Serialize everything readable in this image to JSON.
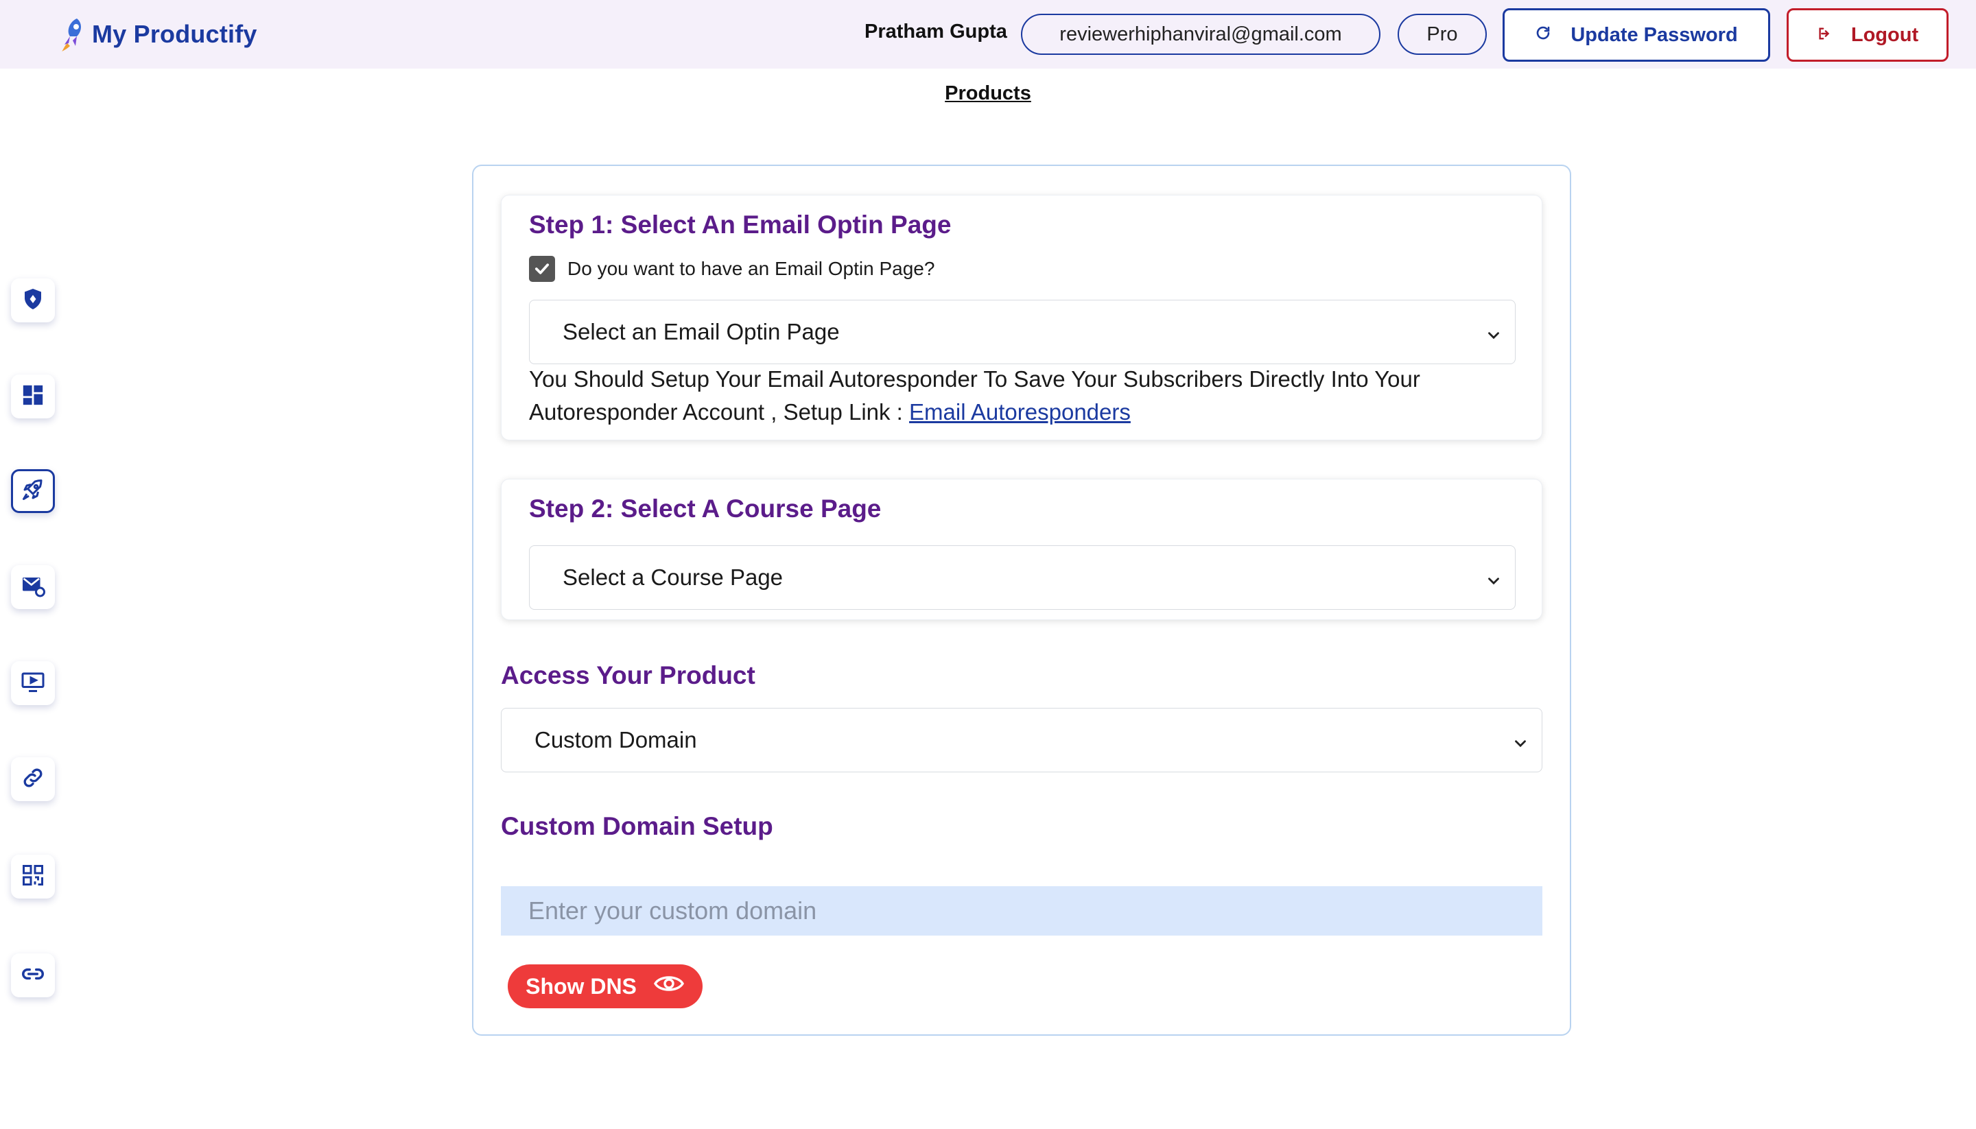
{
  "header": {
    "brand": "My Productify",
    "user_name": "Pratham Gupta",
    "email": "reviewerhiphanviral@gmail.com",
    "plan": "Pro",
    "update_password_label": "Update Password",
    "logout_label": "Logout"
  },
  "nav": {
    "current_page": "Products"
  },
  "sidebar": {
    "items": [
      {
        "icon": "shield-icon"
      },
      {
        "icon": "dashboard-icon"
      },
      {
        "icon": "rocket-icon",
        "active": true
      },
      {
        "icon": "mail-icon"
      },
      {
        "icon": "video-icon"
      },
      {
        "icon": "link-icon"
      },
      {
        "icon": "qr-code-icon"
      },
      {
        "icon": "chain-link-icon"
      }
    ]
  },
  "step1": {
    "title": "Step 1: Select An Email Optin Page",
    "checkbox_label": "Do you want to have an Email Optin Page?",
    "checkbox_checked": true,
    "select_value": "Select an Email Optin Page",
    "note_text": "You Should Setup Your Email Autoresponder To Save Your Subscribers Directly Into Your Autoresponder Account , Setup Link : ",
    "note_link": "Email Autoresponders"
  },
  "step2": {
    "title": "Step 2: Select A Course Page",
    "select_value": "Select a Course Page"
  },
  "access": {
    "title": "Access Your Product",
    "select_value": "Custom Domain"
  },
  "custom_domain": {
    "title": "Custom Domain Setup",
    "placeholder": "Enter your custom domain",
    "show_dns_label": "Show DNS"
  },
  "colors": {
    "brand_blue": "#1b3aa0",
    "heading_purple": "#5b1c8a",
    "logout_red": "#b01825",
    "dns_red": "#ee3b3b",
    "input_bg": "#d9e7fc"
  }
}
